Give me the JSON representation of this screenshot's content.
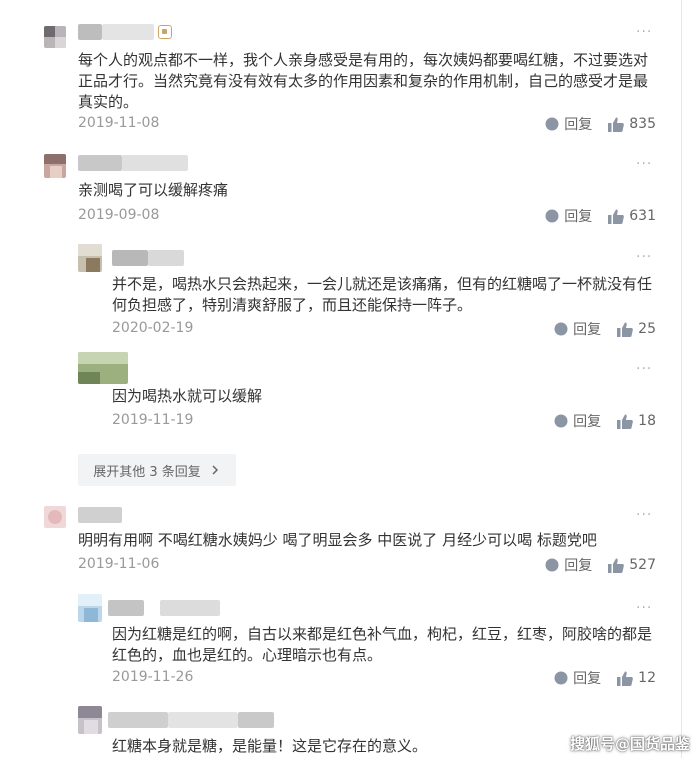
{
  "reply_label": "回复",
  "menu_glyph": "···",
  "expand_label": "展开其他 3 条回复",
  "watermark": "搜狐号@国货品鉴",
  "comments": [
    {
      "lines": [
        "每个人的观点都不一样，我个人亲身感受是有用的，每次姨妈都要喝红糖，不过要选对",
        "正品才行。当然究竟有没有效有太多的作用因素和复杂的作用机制，自己的感受才是最",
        "真实的。"
      ],
      "date": "2019-11-08",
      "likes": "835"
    },
    {
      "lines": [
        "亲测喝了可以缓解疼痛"
      ],
      "date": "2019-09-08",
      "likes": "631"
    },
    {
      "lines": [
        "并不是，喝热水只会热起来，一会儿就还是该痛痛，但有的红糖喝了一杯就没有任",
        "何负担感了，特别清爽舒服了，而且还能保持一阵子。"
      ],
      "date": "2020-02-19",
      "likes": "25"
    },
    {
      "lines": [
        "因为喝热水就可以缓解"
      ],
      "date": "2019-11-19",
      "likes": "18"
    },
    {
      "lines": [
        "明明有用啊 不喝红糖水姨妈少 喝了明显会多 中医说了 月经少可以喝 标题党吧"
      ],
      "date": "2019-11-06",
      "likes": "527"
    },
    {
      "lines": [
        "因为红糖是红的啊，自古以来都是红色补气血，枸杞，红豆，红枣，阿胶啥的都是",
        "红色的，血也是红的。心理暗示也有点。"
      ],
      "date": "2019-11-26",
      "likes": "12"
    },
    {
      "lines": [
        "红糖本身就是糖，是能量！这是它存在的意义。"
      ]
    }
  ]
}
